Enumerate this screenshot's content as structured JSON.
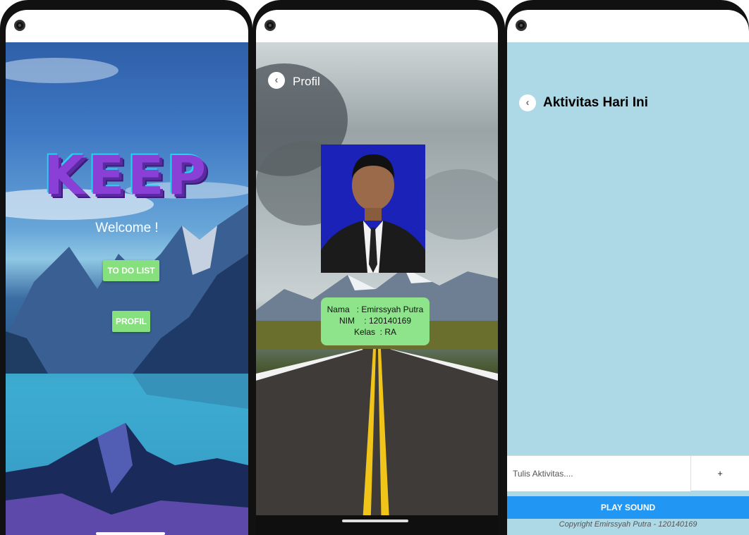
{
  "screen1": {
    "logo": "KEEP",
    "welcome": "Welcome !",
    "todo_button": "TO DO LIST",
    "profil_button": "PROFIL"
  },
  "screen2": {
    "title": "Profil",
    "back_icon": "chevron-left-icon",
    "nama_line": "Nama   : Emirssyah Putra",
    "nim_line": "NIM    : 120140169",
    "kelas_line": "Kelas  : RA"
  },
  "screen3": {
    "title": "Aktivitas Hari Ini",
    "back_icon": "chevron-left-icon",
    "input_placeholder": "Tulis Aktivitas....",
    "add_label": "+",
    "play_button": "PLAY SOUND",
    "copyright": "Copyright Emirssyah Putra - 120140169"
  },
  "colors": {
    "green_button": "#86e07d",
    "play_button": "#2196f3",
    "list_background": "#add8e6",
    "photo_background": "#1a22b8"
  }
}
